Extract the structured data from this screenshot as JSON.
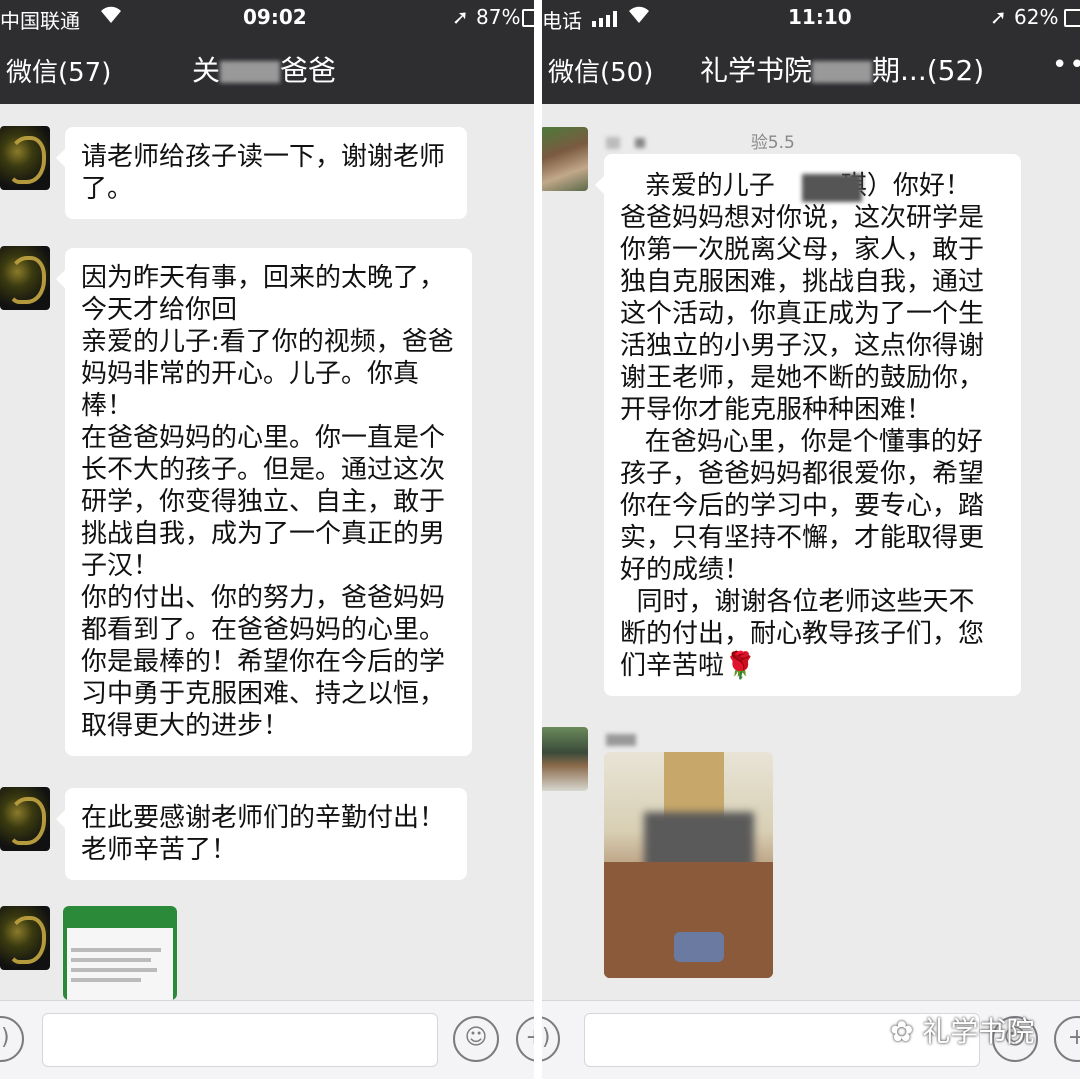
{
  "left": {
    "status": {
      "carrier": "中国联通",
      "time": "09:02",
      "battery": "87%"
    },
    "nav": {
      "back": "微信(57)",
      "title_a": "关",
      "title_b": "爸爸"
    },
    "messages": [
      {
        "lines": [
          "请老师给孩子读一下，谢谢老师",
          "了。"
        ]
      },
      {
        "lines": [
          "因为昨天有事，回来的太晚了，",
          "今天才给你回",
          "亲爱的儿子:看了你的视频，爸爸",
          "妈妈非常的开心。儿子。你真",
          "棒！",
          "在爸爸妈妈的心里。你一直是个",
          "长不大的孩子。但是。通过这次",
          "研学，你变得独立、自主，敢于",
          "挑战自我，成为了一个真正的男",
          "子汉！",
          "你的付出、你的努力，爸爸妈妈",
          "都看到了。在爸爸妈妈的心里。",
          "你是最棒的！希望你在今后的学",
          "习中勇于克服困难、持之以恒，",
          "取得更大的进步！"
        ]
      },
      {
        "lines": [
          "在此要感谢老师们的辛勤付出！",
          "老师辛苦了！"
        ]
      }
    ]
  },
  "right": {
    "status": {
      "carrier": "电话",
      "time": "11:10",
      "battery": "62%"
    },
    "nav": {
      "back": "微信(50)",
      "title_a": "礼学书院",
      "title_b": "期...(52)"
    },
    "sender1_name": "验5.5",
    "message_lines": [
      "   亲爱的儿子        琪）你好！",
      "爸爸妈妈想对你说，这次研学是",
      "你第一次脱离父母，家人，敢于",
      "独自克服困难，挑战自我，通过",
      "这个活动，你真正成为了一个生",
      "活独立的小男子汉，这点你得谢",
      "谢王老师，是她不断的鼓励你，",
      "开导你才能克服种种困难！",
      "   在爸妈心里，你是个懂事的好",
      "孩子，爸爸妈妈都很爱你，希望",
      "你在今后的学习中，要专心，踏",
      "实，只有坚持不懈，才能取得更",
      "好的成绩！",
      "  同时，谢谢各位老师这些天不",
      "断的付出，耐心教导孩子们，您",
      "们辛苦啦🌹"
    ]
  },
  "watermark": "礼学书院",
  "icons": {
    "wifi": "wifi-icon",
    "location": "location-arrow-icon",
    "voice": "voice-icon",
    "emoji": "emoji-icon",
    "plus": "plus-icon"
  }
}
